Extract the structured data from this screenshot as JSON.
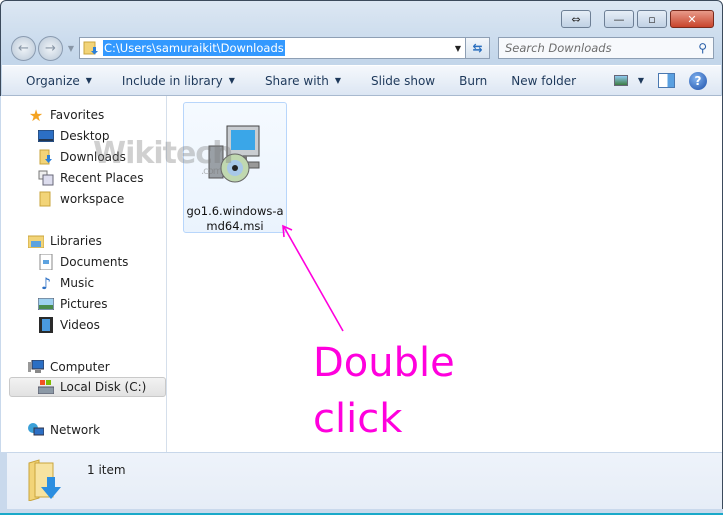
{
  "window": {
    "caption_buttons": {
      "snap": "⇔",
      "minimize": "—",
      "maximize": "▫",
      "close": "✕"
    }
  },
  "address_bar": {
    "path": "C:\\Users\\samuraikit\\Downloads"
  },
  "search": {
    "placeholder": "Search Downloads"
  },
  "toolbar": {
    "items": [
      {
        "label": "Organize",
        "has_dropdown": true
      },
      {
        "label": "Include in library",
        "has_dropdown": true
      },
      {
        "label": "Share with",
        "has_dropdown": true
      },
      {
        "label": "Slide show",
        "has_dropdown": false
      },
      {
        "label": "Burn",
        "has_dropdown": false
      },
      {
        "label": "New folder",
        "has_dropdown": false
      }
    ],
    "help": "?"
  },
  "sidebar": {
    "favorites": {
      "label": "Favorites",
      "items": [
        "Desktop",
        "Downloads",
        "Recent Places",
        "workspace"
      ]
    },
    "libraries": {
      "label": "Libraries",
      "items": [
        "Documents",
        "Music",
        "Pictures",
        "Videos"
      ]
    },
    "computer": {
      "label": "Computer",
      "items": [
        "Local Disk (C:)"
      ],
      "selected": "Local Disk (C:)"
    },
    "network": {
      "label": "Network"
    }
  },
  "files": [
    {
      "name": "go1.6.windows-amd64.msi",
      "name_line1": "go1.6.windows-a",
      "name_line2": "md64.msi",
      "type": "msi-installer"
    }
  ],
  "watermark": {
    "text": "Wikitech",
    "sub": ".com"
  },
  "annotation": {
    "line1": "Double",
    "line2": "click",
    "color": "#ff00dd"
  },
  "status_bar": {
    "count": "1 item"
  }
}
